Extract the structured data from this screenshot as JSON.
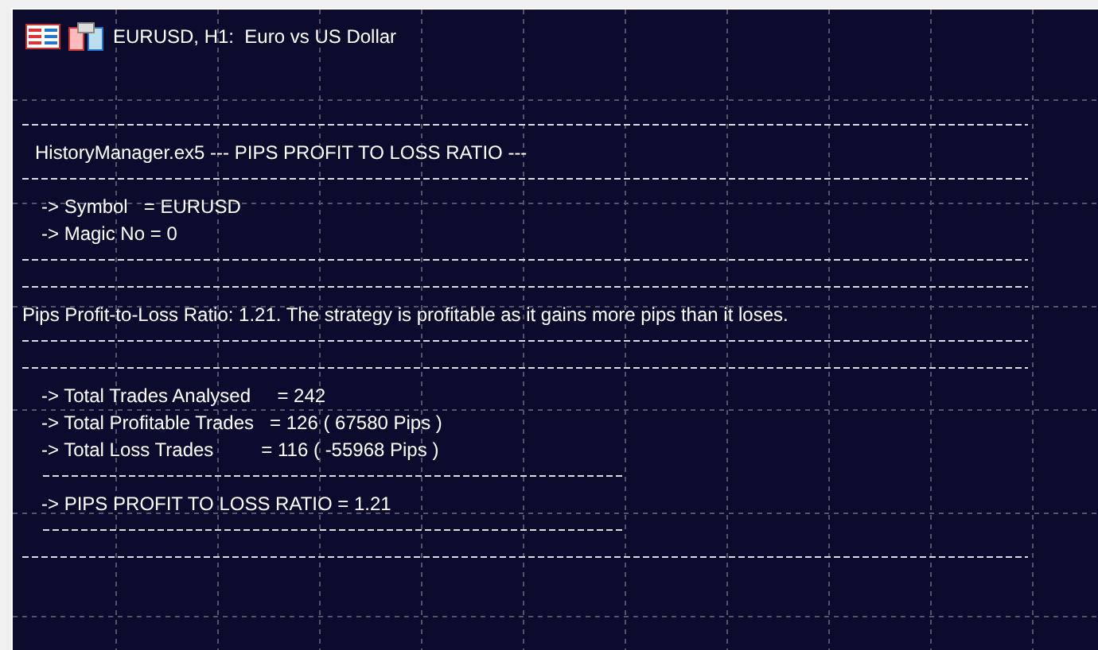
{
  "window": {
    "title": "EURUSD, H1:  Euro vs US Dollar"
  },
  "report": [
    {
      "kind": "rule"
    },
    {
      "kind": "heading",
      "text": "HistoryManager.ex5 --- PIPS PROFIT TO LOSS RATIO ---"
    },
    {
      "kind": "rule"
    },
    {
      "kind": "item",
      "text": "-> Symbol   = EURUSD"
    },
    {
      "kind": "item",
      "text": "-> Magic No = 0"
    },
    {
      "kind": "rule"
    },
    {
      "kind": "rule"
    },
    {
      "kind": "sentence",
      "text": "Pips Profit-to-Loss Ratio: 1.21. The strategy is profitable as it gains more pips than it loses."
    },
    {
      "kind": "rule"
    },
    {
      "kind": "rule"
    },
    {
      "kind": "item",
      "text": "-> Total Trades Analysed     = 242"
    },
    {
      "kind": "item",
      "text": "-> Total Profitable Trades   = 126 ( 67580 Pips )"
    },
    {
      "kind": "item",
      "text": "-> Total Loss Trades         = 116 ( -55968 Pips )"
    },
    {
      "kind": "short-rule"
    },
    {
      "kind": "item",
      "text": "-> PIPS PROFIT TO LOSS RATIO = 1.21"
    },
    {
      "kind": "short-rule"
    },
    {
      "kind": "rule"
    }
  ]
}
